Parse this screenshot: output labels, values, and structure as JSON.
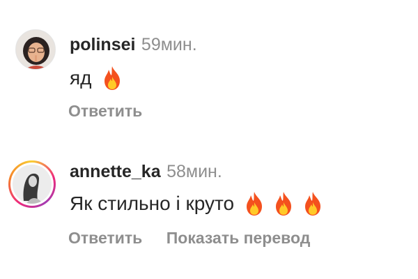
{
  "comments": [
    {
      "username": "polinsei",
      "time": "59мин.",
      "text": "яд",
      "emoji_count": 1,
      "emoji": "fire-icon",
      "has_story_ring": false,
      "actions": {
        "reply": "Ответить"
      }
    },
    {
      "username": "annette_ka",
      "time": "58мин.",
      "text": "Як стильно і круто",
      "emoji_count": 3,
      "emoji": "fire-icon",
      "has_story_ring": true,
      "actions": {
        "reply": "Ответить",
        "translate": "Показать перевод"
      }
    }
  ],
  "colors": {
    "text": "#262626",
    "secondary": "#8e8e8e",
    "background": "#ffffff",
    "fire_outer": "#f4511e",
    "fire_inner": "#ffca28"
  }
}
